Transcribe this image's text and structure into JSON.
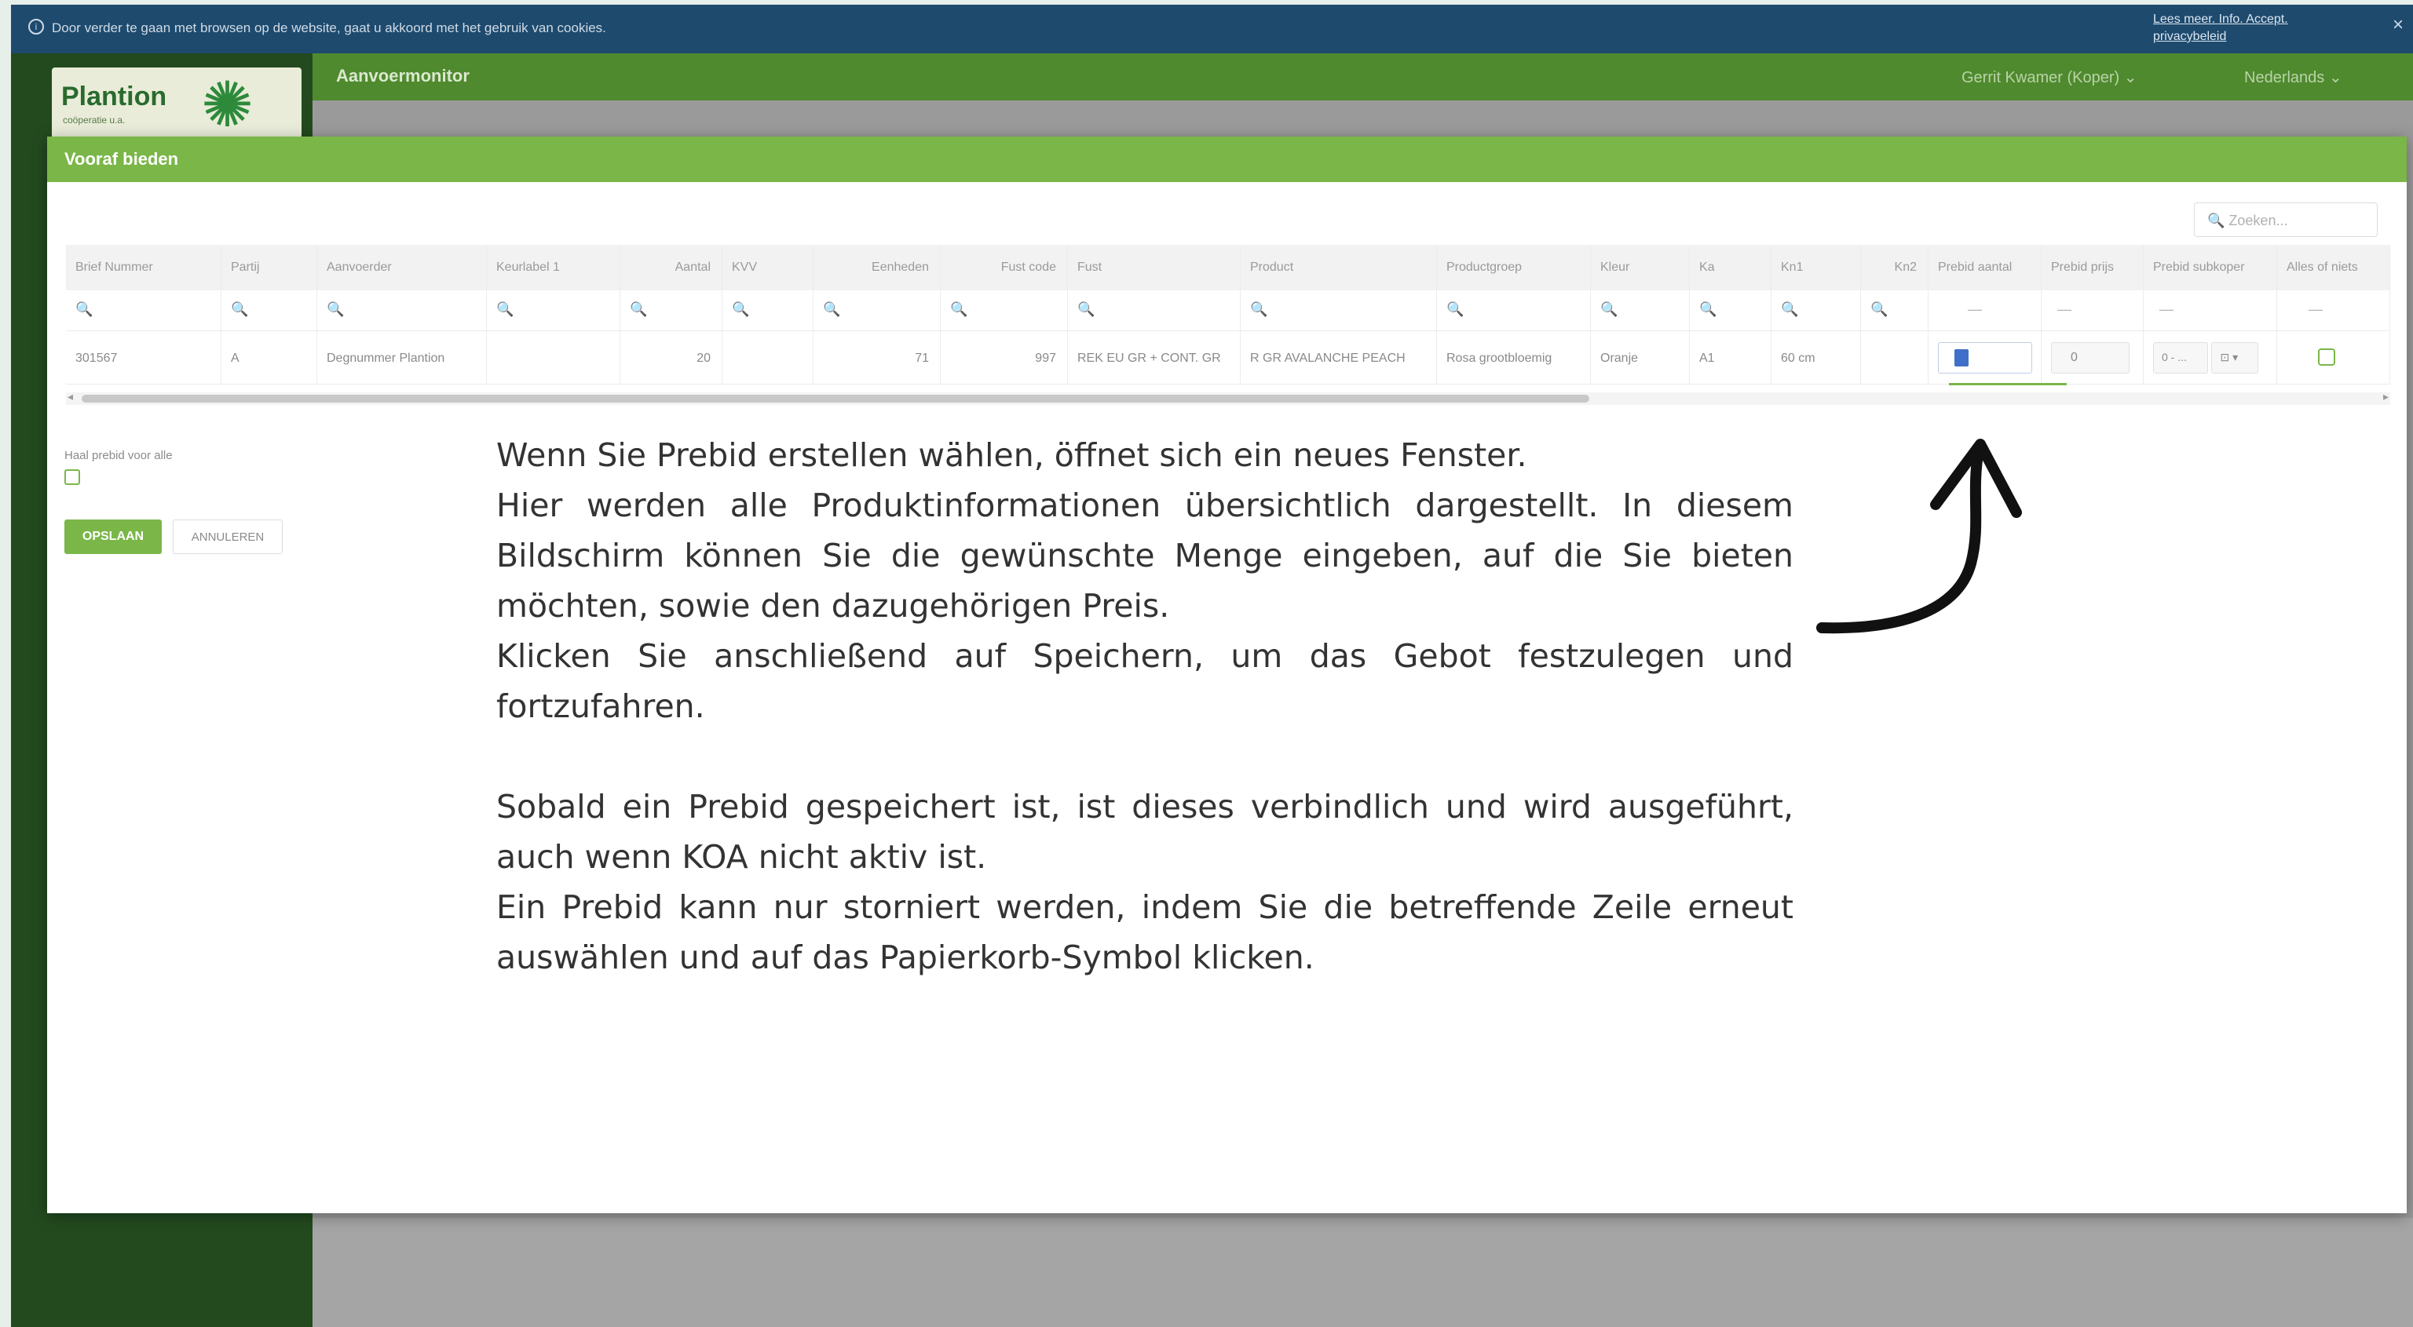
{
  "cookie_bar": {
    "message": "Door verder te gaan met browsen op de website, gaat u akkoord met het gebruik van cookies.",
    "link": "Lees meer. Info. Accept. privacybeleid",
    "close": "×"
  },
  "logo": {
    "name": "Plantion",
    "sub": "coöperatie u.a."
  },
  "topnav": {
    "title": "Aanvoermonitor",
    "user": "Gerrit Kwamer (Koper)  ⌄",
    "language": "Nederlands  ⌄"
  },
  "modal": {
    "title": "Vooraf bieden",
    "search_placeholder": "🔍  Zoeken...",
    "columns": [
      "Brief Nummer",
      "Partij",
      "Aanvoerder",
      "Keurlabel 1",
      "Aantal",
      "KVV",
      "Eenheden",
      "Fust code",
      "Fust",
      "Product",
      "Productgroep",
      "Kleur",
      "Ka",
      "Kn1",
      "Kn2",
      "Prebid aantal",
      "Prebid prijs",
      "Prebid subkoper",
      "Alles of niets"
    ],
    "filter_symbol": "🔍",
    "dash": "—",
    "row": {
      "brief": "301567",
      "partij": "A",
      "aanvoerder": "Degnummer Plantion",
      "keurlabel": "",
      "aantal": "20",
      "kvv": "",
      "eenheden": "71",
      "fust_code": "997",
      "fust": "REK EU GR + CONT. GR",
      "product": "R GR AVALANCHE PEACH",
      "productgroep": "Rosa grootbloemig",
      "kleur": "Oranje",
      "ka": "A1",
      "kn1": "60 cm",
      "kn2": "",
      "prebid_prijs": "0",
      "prebid_subkoper": "0 - ...",
      "prebid_subkoper2": "⊡ ▾"
    },
    "all_label": "Haal prebid voor alle",
    "save_button": "OPSLAAN",
    "cancel_button": "ANNULEREN"
  },
  "instructions": {
    "p1": "Wenn Sie Prebid erstellen wählen, öffnet sich ein neues Fenster.",
    "p2": "Hier werden alle Produktinformationen übersichtlich dargestellt. In diesem Bildschirm können Sie die gewünschte Menge eingeben, auf die Sie bieten möchten, sowie den dazugehörigen Preis.",
    "p3": "Klicken Sie anschließend auf Speichern, um das Gebot festzulegen und fortzufahren.",
    "p4": "Sobald ein Prebid gespeichert ist, ist dieses verbindlich und wird ausgeführt, auch wenn KOA nicht aktiv ist.",
    "p5": "Ein Prebid kann nur storniert werden, indem Sie die betreffende Zeile erneut auswählen und auf das Papierkorb-Symbol klicken."
  },
  "colors": {
    "brand_green": "#7ab648",
    "dark_green": "#234a1f",
    "cookie_blue": "#1e4a6e",
    "arrow": "#111111"
  }
}
